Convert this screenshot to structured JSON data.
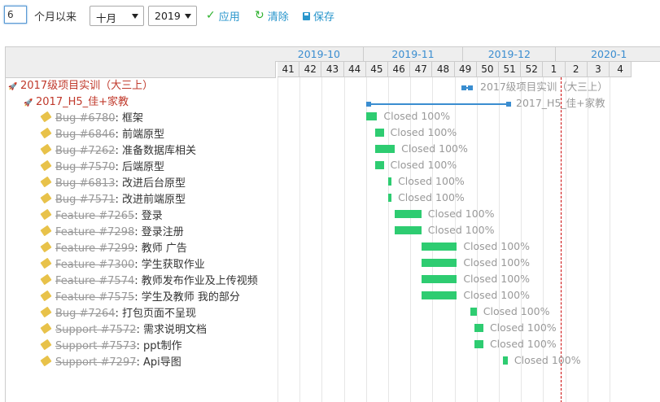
{
  "toolbar": {
    "months_value": "6",
    "months_label": "个月以来",
    "month_select": "十月",
    "year_select": "2019",
    "apply_label": "应用",
    "clear_label": "清除",
    "save_label": "保存"
  },
  "months": [
    "2019-10",
    "2019-11",
    "2019-12",
    "2020-1"
  ],
  "weeks": [
    "41",
    "42",
    "43",
    "44",
    "45",
    "46",
    "47",
    "48",
    "49",
    "50",
    "51",
    "52",
    "1",
    "2",
    "3",
    "4"
  ],
  "projects": [
    {
      "name": "2017级项目实训（大三上）",
      "label": "2017级项目实训（大三上）"
    },
    {
      "name": "2017_H5_佳+家教",
      "label": "2017_H5_佳+家教"
    }
  ],
  "issues": [
    {
      "ref": "Bug #6780",
      "subject": "框架",
      "status": "Closed 100%"
    },
    {
      "ref": "Bug #6846",
      "subject": "前端原型",
      "status": "Closed 100%"
    },
    {
      "ref": "Bug #7262",
      "subject": "准备数据库相关",
      "status": "Closed 100%"
    },
    {
      "ref": "Bug #7570",
      "subject": "后端原型",
      "status": "Closed 100%"
    },
    {
      "ref": "Bug #6813",
      "subject": "改进后台原型",
      "status": "Closed 100%"
    },
    {
      "ref": "Bug #7571",
      "subject": "改进前端原型",
      "status": "Closed 100%"
    },
    {
      "ref": "Feature #7265",
      "subject": "登录",
      "status": "Closed 100%"
    },
    {
      "ref": "Feature #7298",
      "subject": "登录注册",
      "status": "Closed 100%"
    },
    {
      "ref": "Feature #7299",
      "subject": "教师 广告",
      "status": "Closed 100%"
    },
    {
      "ref": "Feature #7300",
      "subject": "学生获取作业",
      "status": "Closed 100%"
    },
    {
      "ref": "Feature #7574",
      "subject": "教师发布作业及上传视频",
      "status": "Closed 100%"
    },
    {
      "ref": "Feature #7575",
      "subject": "学生及教师 我的部分",
      "status": "Closed 100%"
    },
    {
      "ref": "Bug #7264",
      "subject": "打包页面不呈现",
      "status": "Closed 100%"
    },
    {
      "ref": "Support #7572",
      "subject": "需求说明文档",
      "status": "Closed 100%"
    },
    {
      "ref": "Support #7573",
      "subject": "ppt制作",
      "status": "Closed 100%"
    },
    {
      "ref": "Support #7297",
      "subject": "Api导图",
      "status": "Closed 100%"
    }
  ]
}
